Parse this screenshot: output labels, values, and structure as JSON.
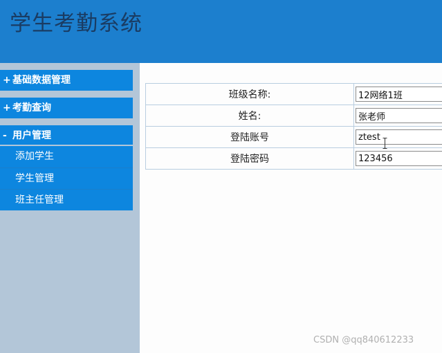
{
  "header": {
    "title": "学生考勤系统"
  },
  "sidebar": {
    "groups": [
      {
        "sign": "+",
        "label": "基础数据管理"
      },
      {
        "sign": "+",
        "label": "考勤查询"
      },
      {
        "sign": "-",
        "label": "用户管理"
      }
    ],
    "sub_items": [
      {
        "label": "添加学生"
      },
      {
        "label": "学生管理"
      },
      {
        "label": "班主任管理"
      }
    ]
  },
  "form": {
    "rows": [
      {
        "label": "班级名称:",
        "value": "12网络1班"
      },
      {
        "label": "姓名:",
        "value": "张老师"
      },
      {
        "label": "登陆账号",
        "value": "ztest"
      },
      {
        "label": "登陆密码",
        "value": "123456"
      }
    ]
  },
  "watermark": "CSDN @qq840612233",
  "colors": {
    "header_bg": "#1c7fce",
    "sidebar_bg": "#b3c6d8",
    "menu_bg": "#0d86df",
    "title_text": "#1a3c63"
  }
}
